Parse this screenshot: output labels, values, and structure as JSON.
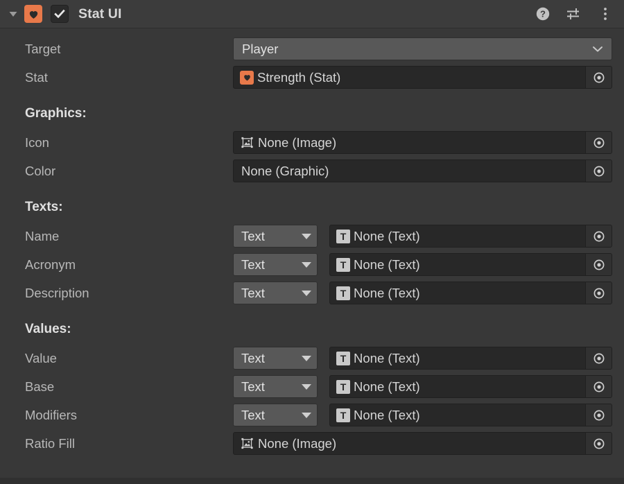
{
  "header": {
    "title": "Stat UI",
    "foldout_icon": "triangle-down-icon",
    "component_icon": "heart-icon",
    "enabled_checkbox": "checked",
    "help_icon": "help-question-icon",
    "preset_icon": "preset-sliders-icon",
    "menu_icon": "three-dot-menu-icon"
  },
  "rows": {
    "target": {
      "label": "Target",
      "value": "Player",
      "control": "popup"
    },
    "stat": {
      "label": "Stat",
      "value": "Strength (Stat)",
      "icon": "heart-icon",
      "control": "object"
    },
    "icon": {
      "label": "Icon",
      "value": "None (Image)",
      "icon": "image-icon",
      "control": "object"
    },
    "color": {
      "label": "Color",
      "value": "None (Graphic)",
      "icon": "",
      "control": "object"
    },
    "name": {
      "label": "Name",
      "enum_value": "Text",
      "value": "None (Text)",
      "icon": "text-icon",
      "control": "enum+object"
    },
    "acronym": {
      "label": "Acronym",
      "enum_value": "Text",
      "value": "None (Text)",
      "icon": "text-icon",
      "control": "enum+object"
    },
    "description": {
      "label": "Description",
      "enum_value": "Text",
      "value": "None (Text)",
      "icon": "text-icon",
      "control": "enum+object"
    },
    "value": {
      "label": "Value",
      "enum_value": "Text",
      "value": "None (Text)",
      "icon": "text-icon",
      "control": "enum+object"
    },
    "base": {
      "label": "Base",
      "enum_value": "Text",
      "value": "None (Text)",
      "icon": "text-icon",
      "control": "enum+object"
    },
    "modifiers": {
      "label": "Modifiers",
      "enum_value": "Text",
      "value": "None (Text)",
      "icon": "text-icon",
      "control": "enum+object"
    },
    "ratio_fill": {
      "label": "Ratio Fill",
      "value": "None (Image)",
      "icon": "image-icon",
      "control": "object"
    }
  },
  "sections": {
    "graphics": "Graphics:",
    "texts": "Texts:",
    "values": "Values:"
  },
  "colors": {
    "background": "#383838",
    "header_bar": "#3c3c3c",
    "accent_orange": "#e8794a",
    "popup_fill": "#585858",
    "object_fill": "#282828",
    "label_text": "#b8b8b8",
    "section_text": "#e0e0e0"
  }
}
